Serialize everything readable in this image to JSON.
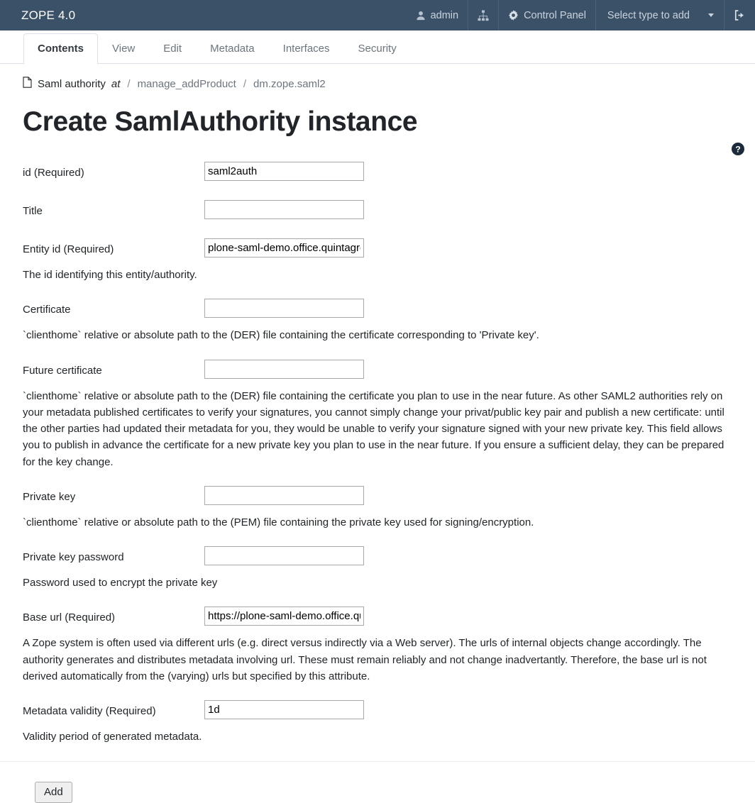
{
  "navbar": {
    "brand": "ZOPE 4.0",
    "user": "admin",
    "user_icon": "user-icon",
    "sitemap_icon": "sitemap-icon",
    "gear_icon": "gear-icon",
    "control_panel": "Control Panel",
    "select_type": "Select type to add",
    "caret_icon": "chevron-down-icon",
    "logout_icon": "logout-icon",
    "bg_color": "#3b5168"
  },
  "tabs": [
    {
      "label": "Contents",
      "active": true
    },
    {
      "label": "View",
      "active": false
    },
    {
      "label": "Edit",
      "active": false
    },
    {
      "label": "Metadata",
      "active": false
    },
    {
      "label": "Interfaces",
      "active": false
    },
    {
      "label": "Security",
      "active": false
    }
  ],
  "breadcrumb": {
    "doc_icon": "document-icon",
    "current": "Saml authority",
    "at": "at",
    "sep": "/",
    "items": [
      "manage_addProduct",
      "dm.zope.saml2"
    ]
  },
  "page_title": "Create SamlAuthority instance",
  "help_icon": "help-circle-icon",
  "form": {
    "fields": [
      {
        "label": "id (Required)",
        "value": "saml2auth",
        "placeholder": "",
        "help": ""
      },
      {
        "label": "Title",
        "value": "",
        "placeholder": "",
        "help": ""
      },
      {
        "label": "Entity id (Required)",
        "value": "plone-saml-demo.office.quintagroup.com",
        "placeholder": "",
        "help": "The id identifying this entity/authority."
      },
      {
        "label": "Certificate",
        "value": "",
        "placeholder": "",
        "help": "`clienthome` relative or absolute path to the (DER) file containing the certificate corresponding to 'Private key'."
      },
      {
        "label": "Future certificate",
        "value": "",
        "placeholder": "",
        "help": "`clienthome` relative or absolute path to the (DER) file containing the certificate you plan to use in the near future. As other SAML2 authorities rely on your metadata published certificates to verify your signatures, you cannot simply change your privat/public key pair and publish a new certificate: until the other parties had updated their metadata for you, they would be unable to verify your signature signed with your new private key. This field allows you to publish in advance the certificate for a new private key you plan to use in the near future. If you ensure a sufficient delay, they can be prepared for the key change."
      },
      {
        "label": "Private key",
        "value": "",
        "placeholder": "",
        "help": "`clienthome` relative or absolute path to the (PEM) file containing the private key used for signing/encryption."
      },
      {
        "label": "Private key password",
        "value": "",
        "placeholder": "",
        "help": "Password used to encrypt the private key"
      },
      {
        "label": "Base url (Required)",
        "value": "https://plone-saml-demo.office.quintagroup.com",
        "placeholder": "",
        "help": "A Zope system is often used via different urls (e.g. direct versus indirectly via a Web server). The urls of internal objects change accordingly. The authority generates and distributes metadata involving url. These must remain reliably and not change inadvertantly. Therefore, the base url is not derived automatically from the (varying) urls but specified by this attribute."
      },
      {
        "label": "Metadata validity (Required)",
        "value": "1d",
        "placeholder": "",
        "help": "Validity period of generated metadata."
      }
    ],
    "submit_label": "Add"
  }
}
